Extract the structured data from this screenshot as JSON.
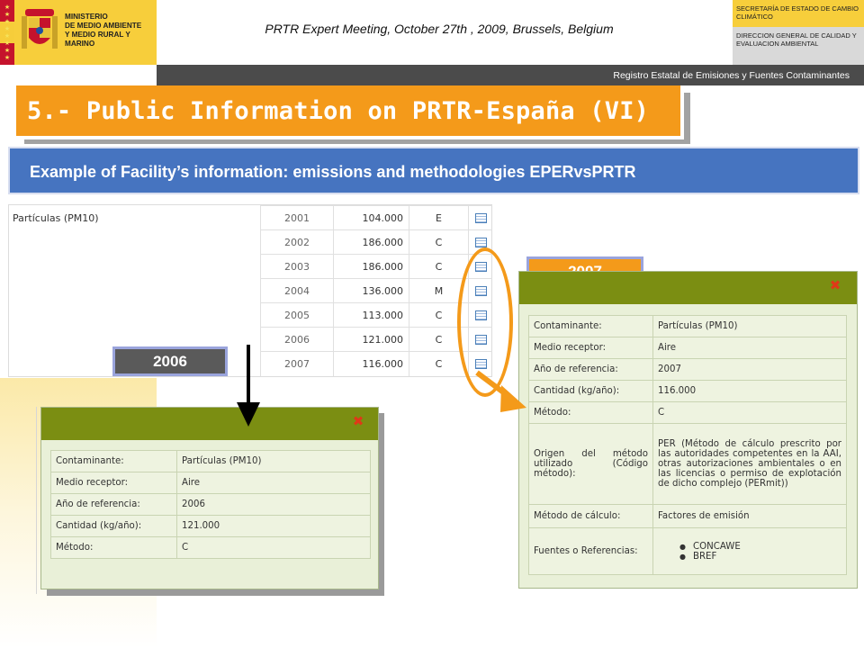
{
  "header": {
    "ministry_line1": "MINISTERIO",
    "ministry_line2": "DE MEDIO AMBIENTE",
    "ministry_line3": "Y MEDIO RURAL Y MARINO",
    "meeting": "PRTR Expert Meeting, October 27th , 2009, Brussels, Belgium",
    "secretaria": "SECRETARÍA DE ESTADO DE CAMBIO CLIMÁTICO",
    "direccion": "DIRECCION GENERAL DE CALIDAD Y EVALUACION AMBIENTAL",
    "registry": "Registro Estatal de Emisiones y Fuentes Contaminantes"
  },
  "slide": {
    "title": "5.- Public Information on PRTR-España (VI)",
    "subtitle": "Example of Facility’s information: emissions and methodologies EPERvsPRTR"
  },
  "emissions": {
    "pollutant": "Partículas (PM10)",
    "rows": [
      {
        "year": "2001",
        "value": "104.000",
        "method": "E"
      },
      {
        "year": "2002",
        "value": "186.000",
        "method": "C"
      },
      {
        "year": "2003",
        "value": "186.000",
        "method": "C"
      },
      {
        "year": "2004",
        "value": "136.000",
        "method": "M"
      },
      {
        "year": "2005",
        "value": "113.000",
        "method": "C"
      },
      {
        "year": "2006",
        "value": "121.000",
        "method": "C"
      },
      {
        "year": "2007",
        "value": "116.000",
        "method": "C"
      }
    ]
  },
  "labels": {
    "y2006": "2006",
    "y2007": "2007"
  },
  "popup2006": {
    "close": "✖",
    "rows": [
      {
        "key": "Contaminante:",
        "value": "Partículas (PM10)"
      },
      {
        "key": "Medio receptor:",
        "value": "Aire"
      },
      {
        "key": "Año de referencia:",
        "value": "2006"
      },
      {
        "key": "Cantidad (kg/año):",
        "value": "121.000"
      },
      {
        "key": "Método:",
        "value": "C"
      }
    ]
  },
  "popup2007": {
    "close": "✖",
    "rows": [
      {
        "key": "Contaminante:",
        "value": "Partículas (PM10)"
      },
      {
        "key": "Medio receptor:",
        "value": "Aire"
      },
      {
        "key": "Año de referencia:",
        "value": "2007"
      },
      {
        "key": "Cantidad (kg/año):",
        "value": "116.000"
      },
      {
        "key": "Método:",
        "value": "C"
      }
    ],
    "origin_key": "Origen del método utilizado (Código método):",
    "origin_value": "PER (Método de cálculo prescrito por las autoridades competentes en la AAI, otras autorizaciones ambientales o en las licencias o permiso de explotación de dicho complejo (PERmit))",
    "calc_key": "Método de cálculo:",
    "calc_value": "Factores de emisión",
    "sources_key": "Fuentes o Referencias:",
    "sources": [
      "CONCAWE",
      "BREF"
    ]
  }
}
